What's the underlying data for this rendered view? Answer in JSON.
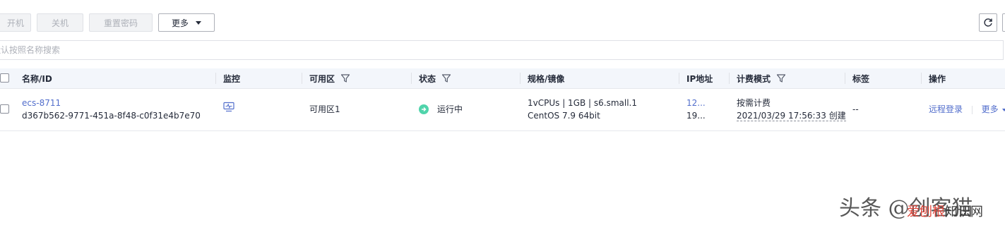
{
  "toolbar": {
    "start_label": "开机",
    "stop_label": "关机",
    "reset_password_label": "重置密码",
    "more_label": "更多"
  },
  "search": {
    "placeholder": "默认按照名称搜索"
  },
  "table": {
    "headers": {
      "name_id": "名称/ID",
      "monitor": "监控",
      "az": "可用区",
      "status": "状态",
      "spec": "规格/镜像",
      "ip": "IP地址",
      "billing": "计费模式",
      "tags": "标签",
      "ops": "操作"
    },
    "rows": [
      {
        "name": "ecs-8711",
        "id": "d367b562-9771-451a-8f48-c0f31e4b7e70",
        "az": "可用区1",
        "status": "运行中",
        "spec_line1": "1vCPUs | 1GB | s6.small.1",
        "spec_line2": "CentOS 7.9 64bit",
        "ip_line1": "12...",
        "ip_line2": "19...",
        "billing_line1": "按需计费",
        "billing_line2": "2021/03/29 17:56:33 创建",
        "tags": "--",
        "op_remote_login": "远程登录",
        "op_more": "更多"
      }
    ]
  },
  "watermark": {
    "line1": "头条 @创客猫",
    "red_text": "爱刨根",
    "black_text": "知识网"
  },
  "colors": {
    "link": "#526ecc",
    "status_running": "#50d4ab",
    "header_bg": "#f3f6fb",
    "disabled_text": "#adb0b8"
  }
}
